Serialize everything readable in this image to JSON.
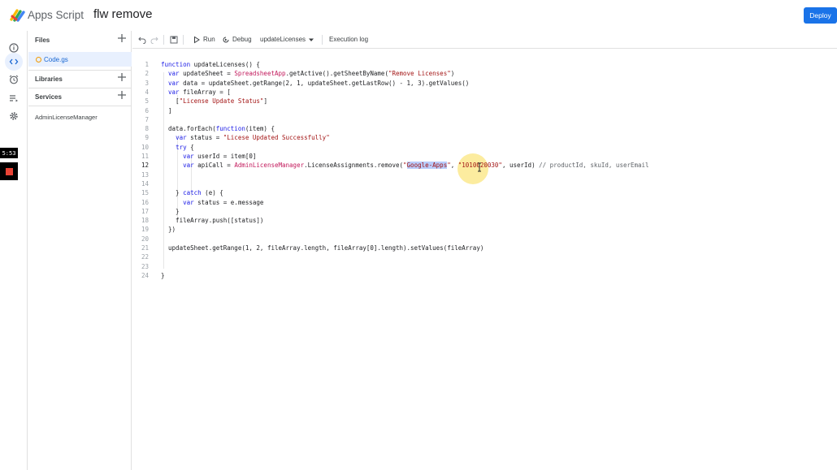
{
  "header": {
    "product_name": "Apps Script",
    "project_name": "flw remove",
    "deploy_label": "Deploy"
  },
  "recorder": {
    "timer": "5:53"
  },
  "files_panel": {
    "files_heading": "Files",
    "file": "Code.gs",
    "libraries_heading": "Libraries",
    "services_heading": "Services",
    "service": "AdminLicenseManager"
  },
  "toolbar": {
    "run_label": "Run",
    "debug_label": "Debug",
    "function_select": "updateLicenses",
    "execution_log_label": "Execution log"
  },
  "editor": {
    "current_line": 12,
    "lines": [
      "function updateLicenses() {",
      "  var updateSheet = SpreadsheetApp.getActive().getSheetByName(\"Remove Licenses\")",
      "  var data = updateSheet.getRange(2, 1, updateSheet.getLastRow() - 1, 3).getValues()",
      "  var fileArray = [",
      "    [\"License Update Status\"]",
      "  ]",
      "",
      "  data.forEach(function(item) {",
      "    var status = \"Licese Updated Successfully\"",
      "    try {",
      "      var userId = item[0]",
      "      var apiCall = AdminLicenseManager.LicenseAssignments.remove(\"Google-Apps\", \"1010020030\", userId) // productId, skuId, userEmail",
      "",
      "",
      "    } catch (e) {",
      "      var status = e.message",
      "    }",
      "    fileArray.push([status])",
      "  })",
      "",
      "  updateSheet.getRange(1, 2, fileArray.length, fileArray[0].length).setValues(fileArray)",
      "",
      "",
      "}"
    ]
  },
  "colors": {
    "accent": "#1a73e8",
    "selection": "#b9cdfb",
    "keyword": "#1a1ae6",
    "string": "#a31515",
    "identifier": "#c2185b"
  },
  "icons": {
    "rail": [
      "info-icon",
      "code-icon",
      "alarm-clock-icon",
      "playlist-icon",
      "gear-icon"
    ],
    "toolbar": [
      "undo-icon",
      "redo-icon",
      "save-icon",
      "play-icon",
      "debug-icon",
      "caret-down-icon"
    ]
  }
}
